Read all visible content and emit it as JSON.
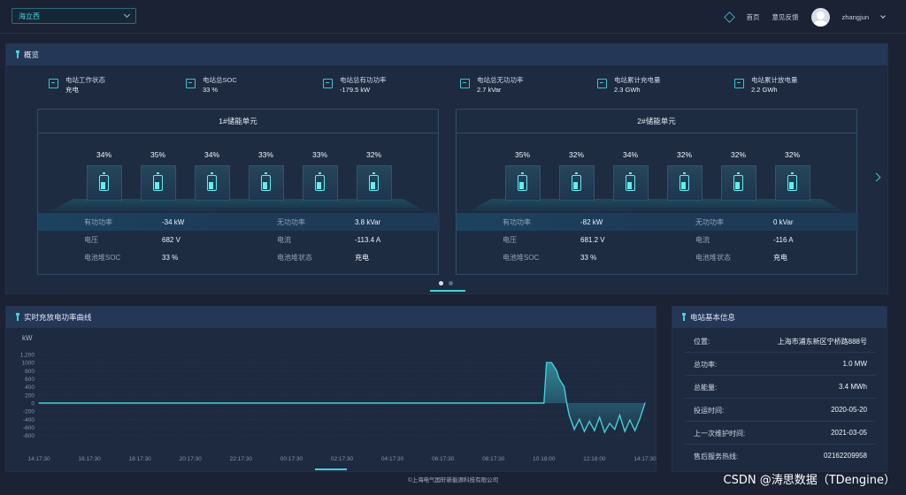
{
  "topbar": {
    "site": "海立西",
    "home": "首页",
    "feedback": "意见反馈",
    "user": "zhangjun"
  },
  "overview": {
    "title": "概览",
    "kpis": [
      {
        "label": "电站工作状态",
        "value": "充电"
      },
      {
        "label": "电站总SOC",
        "value": "33 %"
      },
      {
        "label": "电站总有功功率",
        "value": "-179.5 kW"
      },
      {
        "label": "电站总无功功率",
        "value": "2.7 kVar"
      },
      {
        "label": "电站累计充电量",
        "value": "2.3 GWh"
      },
      {
        "label": "电站累计放电量",
        "value": "2.2 GWh"
      }
    ],
    "units": [
      {
        "title": "1#储能单元",
        "batteries": [
          "34%",
          "35%",
          "34%",
          "33%",
          "33%",
          "32%"
        ],
        "rows": [
          {
            "l1": "有功功率",
            "v1": "-34 kW",
            "l2": "无功功率",
            "v2": "3.8 kVar"
          },
          {
            "l1": "电压",
            "v1": "682 V",
            "l2": "电流",
            "v2": "-113.4 A"
          },
          {
            "l1": "电池堆SOC",
            "v1": "33 %",
            "l2": "电池堆状态",
            "v2": "充电"
          }
        ]
      },
      {
        "title": "2#储能单元",
        "batteries": [
          "35%",
          "32%",
          "34%",
          "32%",
          "32%",
          "32%"
        ],
        "rows": [
          {
            "l1": "有功功率",
            "v1": "-82 kW",
            "l2": "无功功率",
            "v2": "0 kVar"
          },
          {
            "l1": "电压",
            "v1": "681.2 V",
            "l2": "电流",
            "v2": "-116 A"
          },
          {
            "l1": "电池堆SOC",
            "v1": "33 %",
            "l2": "电池堆状态",
            "v2": "充电"
          }
        ]
      }
    ]
  },
  "realtime": {
    "title": "实时充放电功率曲线"
  },
  "chart_data": {
    "type": "line",
    "ylabel": "kW",
    "ylim": [
      -1200,
      1200
    ],
    "yticks": [
      "1,200",
      "1000",
      "800",
      "600",
      "400",
      "200",
      "0",
      "-200",
      "-400",
      "-600",
      "-800"
    ],
    "yticks_values": [
      1200,
      1000,
      800,
      600,
      400,
      200,
      0,
      -200,
      -400,
      -600,
      -800
    ],
    "xlabels": [
      "14:17:30",
      "16:17:30",
      "18:17:30",
      "20:17:30",
      "22:17:30",
      "00:17:30",
      "02:17:30",
      "04:17:30",
      "06:17:30",
      "08:17:30",
      "10:18:00",
      "12:18:00",
      "14:17:30"
    ],
    "grid": true,
    "color": "#3ed2da",
    "series": [
      {
        "name": "",
        "x_hours": [
          0,
          1,
          2,
          3,
          4,
          5,
          6,
          7,
          8,
          9,
          10,
          11,
          12,
          13,
          14,
          15,
          16,
          17,
          18,
          19,
          20,
          20.1,
          20.3,
          20.5,
          20.6,
          20.8,
          20.9,
          21.0,
          21.2,
          21.4,
          21.6,
          21.8,
          22.0,
          22.2,
          22.4,
          22.6,
          22.8,
          23.0,
          23.2,
          23.4,
          23.6,
          23.8,
          24.0
        ],
        "values": [
          0,
          0,
          0,
          0,
          0,
          0,
          0,
          0,
          0,
          0,
          0,
          0,
          0,
          0,
          0,
          0,
          0,
          0,
          0,
          0,
          0,
          1000,
          1000,
          800,
          600,
          400,
          0,
          -300,
          -650,
          -400,
          -700,
          -450,
          -680,
          -350,
          -720,
          -500,
          -650,
          -300,
          -700,
          -420,
          -680,
          -380,
          0
        ]
      }
    ]
  },
  "station_info": {
    "title": "电站基本信息",
    "rows": [
      {
        "label": "位置:",
        "value": "上海市浦东新区宁桥路888号"
      },
      {
        "label": "总功率:",
        "value": "1.0 MW"
      },
      {
        "label": "总能量:",
        "value": "3.4 MWh"
      },
      {
        "label": "投运时间:",
        "value": "2020-05-20"
      },
      {
        "label": "上一次维护时间:",
        "value": "2021-03-05"
      },
      {
        "label": "售后服务热线:",
        "value": "02162209958"
      }
    ]
  },
  "footer": "©上海电气国轩新能源科技有限公司",
  "watermark": "CSDN @涛思数据（TDengine）"
}
